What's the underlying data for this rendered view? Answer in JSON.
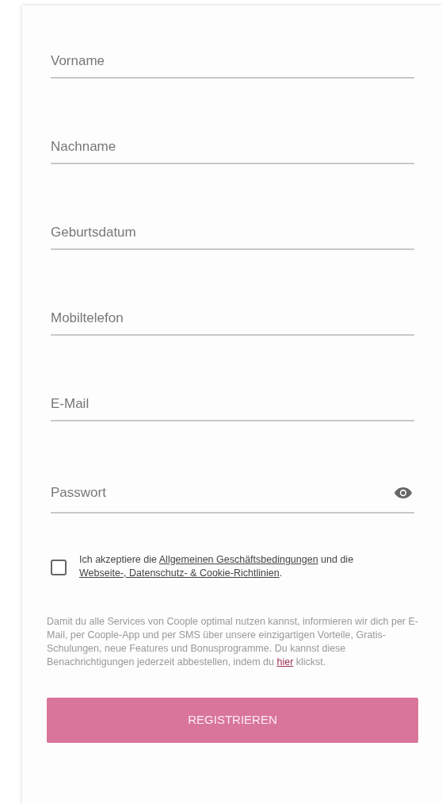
{
  "fields": [
    {
      "kind": "text",
      "placeholder": "Vorname"
    },
    {
      "kind": "text",
      "placeholder": "Nachname"
    },
    {
      "kind": "text",
      "placeholder": "Geburtsdatum"
    },
    {
      "kind": "text",
      "placeholder": "Mobiltelefon"
    },
    {
      "kind": "text",
      "placeholder": "E-Mail"
    },
    {
      "kind": "password",
      "placeholder": "Passwort"
    }
  ],
  "consent": {
    "checked": false,
    "parts": [
      {
        "kind": "text",
        "text": "Ich akzeptiere die "
      },
      {
        "kind": "link",
        "text": "Allgemeinen Geschäftsbedingungen"
      },
      {
        "kind": "text",
        "text": " und die "
      },
      {
        "kind": "link",
        "text": "Webseite-, Datenschutz- & Cookie-Richtlinien"
      },
      {
        "kind": "text",
        "text": "."
      }
    ]
  },
  "notice": {
    "parts": [
      {
        "kind": "text",
        "text": "Damit du alle Services von Coople optimal nutzen kannst, informieren wir dich per E-Mail, per Coople-App und per SMS über unsere einzigartigen Vorteile, Gratis-Schulungen, neue Features und Bonusprogramme. Du kannst diese Benachrichtigungen jederzeit abbestellen, indem du "
      },
      {
        "kind": "link",
        "text": "hier"
      },
      {
        "kind": "text",
        "text": " klickst."
      }
    ]
  },
  "submit": {
    "label": "REGISTRIEREN",
    "disabled": true
  }
}
